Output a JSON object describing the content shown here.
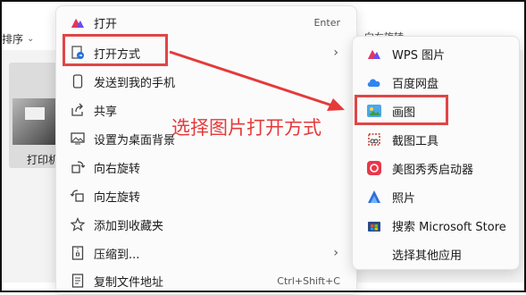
{
  "background": {
    "sort_label": "排序",
    "right_fragment": "向右旋转",
    "file_label": "打印机"
  },
  "context_menu": {
    "items": [
      {
        "label": "打开",
        "shortcut": "Enter",
        "icon": "open-icon"
      },
      {
        "label": "打开方式",
        "shortcut": "",
        "icon": "open-with-icon",
        "has_submenu": true
      },
      {
        "label": "发送到我的手机",
        "shortcut": "",
        "icon": "phone-icon"
      },
      {
        "label": "共享",
        "shortcut": "",
        "icon": "share-icon"
      },
      {
        "label": "设置为桌面背景",
        "shortcut": "",
        "icon": "wallpaper-icon"
      },
      {
        "label": "向右旋转",
        "shortcut": "",
        "icon": "rotate-right-icon"
      },
      {
        "label": "向左旋转",
        "shortcut": "",
        "icon": "rotate-left-icon"
      },
      {
        "label": "添加到收藏夹",
        "shortcut": "",
        "icon": "star-icon"
      },
      {
        "label": "压缩到...",
        "shortcut": "",
        "icon": "zip-icon",
        "has_submenu": true
      },
      {
        "label": "复制文件地址",
        "shortcut": "Ctrl+Shift+C",
        "icon": "copy-path-icon"
      }
    ]
  },
  "submenu": {
    "items": [
      {
        "label": "WPS 图片",
        "icon": "wps-icon"
      },
      {
        "label": "百度网盘",
        "icon": "cloud-icon"
      },
      {
        "label": "画图",
        "icon": "paint-icon"
      },
      {
        "label": "截图工具",
        "icon": "snipping-icon"
      },
      {
        "label": "美图秀秀启动器",
        "icon": "meitu-icon"
      },
      {
        "label": "照片",
        "icon": "photos-icon"
      },
      {
        "label": "搜索 Microsoft Store",
        "icon": "store-icon"
      },
      {
        "label": "选择其他应用",
        "icon": ""
      }
    ]
  },
  "annotation": {
    "text": "选择图片打开方式",
    "color": "#e53a3a"
  }
}
